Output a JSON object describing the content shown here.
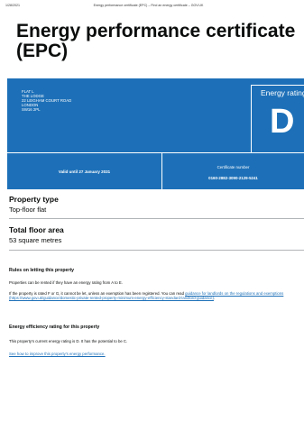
{
  "print_header": {
    "date": "1/28/2021",
    "title": "Energy performance certificate (EPC) – Find an energy certificate – GOV.UK"
  },
  "page_title": "Energy performance certificate (EPC)",
  "epc": {
    "address_lines": [
      "FLAT L",
      "THE LODGE",
      "22 LEIGHAM COURT ROAD",
      "LONDON",
      "SW16 2PL"
    ],
    "rating_label": "Energy rating",
    "rating": "D",
    "valid_until": "Valid until 27 January 2031",
    "certificate_label": "Certificate number",
    "certificate_number": "0160-2882-3090-2129-5241",
    "colors": {
      "panel": "#1d70b8",
      "text": "#ffffff"
    }
  },
  "property_type": {
    "label": "Property type",
    "value": "Top-floor flat"
  },
  "floor_area": {
    "label": "Total floor area",
    "value": "53 square metres"
  },
  "rules": {
    "title": "Rules on letting this property",
    "para1": "Properties can be rented if they have an energy rating from A to E.",
    "para2_text": "If the property is rated F or G, it cannot be let, unless an exemption has been registered. You can read ",
    "para2_link": "guidance for landlords on the regulations and exemptions (https://www.gov.uk/guidance/domestic-private-rented-property-minimum-energy-efficiency-standard-landlord-guidance)",
    "para2_end": "."
  },
  "efficiency": {
    "title": "Energy efficiency rating for this property",
    "para": "This property's current energy rating is D. It has the potential to be C.",
    "link": "See how to improve this property's energy performance."
  }
}
